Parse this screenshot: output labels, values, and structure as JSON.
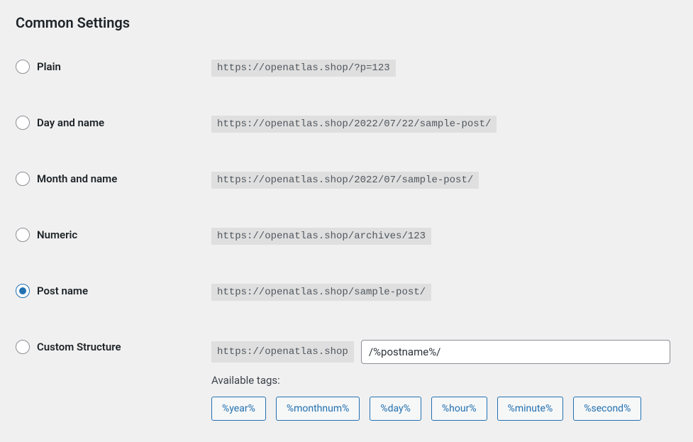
{
  "section_title": "Common Settings",
  "options": {
    "plain": {
      "label": "Plain",
      "sample": "https://openatlas.shop/?p=123"
    },
    "day_name": {
      "label": "Day and name",
      "sample": "https://openatlas.shop/2022/07/22/sample-post/"
    },
    "month_name": {
      "label": "Month and name",
      "sample": "https://openatlas.shop/2022/07/sample-post/"
    },
    "numeric": {
      "label": "Numeric",
      "sample": "https://openatlas.shop/archives/123"
    },
    "post_name": {
      "label": "Post name",
      "sample": "https://openatlas.shop/sample-post/"
    },
    "custom": {
      "label": "Custom Structure",
      "prefix": "https://openatlas.shop",
      "value": "/%postname%/"
    }
  },
  "selected": "post_name",
  "available_tags_label": "Available tags:",
  "tags": [
    "%year%",
    "%monthnum%",
    "%day%",
    "%hour%",
    "%minute%",
    "%second%"
  ]
}
